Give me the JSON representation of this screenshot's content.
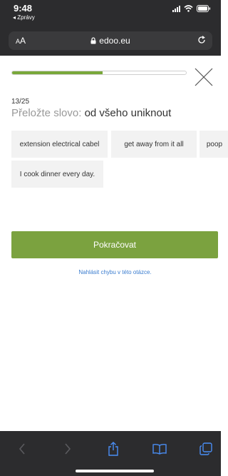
{
  "status_bar": {
    "time": "9:48",
    "back_app": "◂ Zprávy"
  },
  "browser": {
    "aa_small": "A",
    "aa_large": "A",
    "url": "edoo.eu"
  },
  "quiz": {
    "progress_fraction": 0.52,
    "counter": "13/25",
    "prompt": "Přeložte slovo:",
    "word": "od všeho uniknout",
    "options": [
      "extension electrical cabel",
      "get away from it all",
      "poop",
      "I cook dinner every day."
    ],
    "continue_label": "Pokračovat",
    "report_label": "Nahlásit chybu v této otázce."
  },
  "colors": {
    "accent_green": "#7ba23f",
    "progress_green": "#79a83a",
    "link_blue": "#3a7ccf",
    "chrome_dark": "#2c2c2e"
  },
  "icons": [
    "close-icon",
    "lock-icon",
    "reload-icon",
    "back-arrow-icon",
    "forward-arrow-icon",
    "share-icon",
    "bookmarks-icon",
    "tabs-icon"
  ]
}
